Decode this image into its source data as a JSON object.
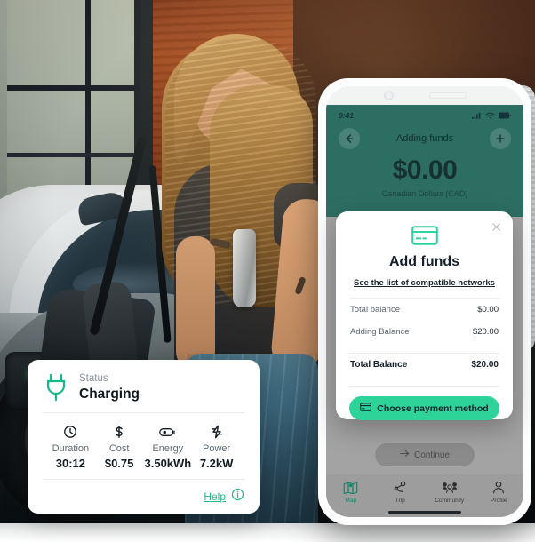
{
  "scene": {
    "description": "Woman leaning on a white electric car while it charges, with app UI overlays"
  },
  "status_card": {
    "icon": "plug-icon",
    "status_label": "Status",
    "status_value": "Charging",
    "metrics": [
      {
        "icon": "clock-icon",
        "label": "Duration",
        "value": "30:12"
      },
      {
        "icon": "dollar-icon",
        "label": "Cost",
        "value": "$0.75"
      },
      {
        "icon": "battery-icon",
        "label": "Energy",
        "value": "3.50kWh"
      },
      {
        "icon": "bolt-icon",
        "label": "Power",
        "value": "7.2kW"
      }
    ],
    "help_label": "Help",
    "help_icon": "info-icon"
  },
  "phone": {
    "status_bar": {
      "time": "9:41",
      "icons": [
        "cellular-signal-icon",
        "wifi-icon",
        "battery-icon"
      ]
    },
    "header": {
      "back_icon": "arrow-left-icon",
      "title": "Adding funds",
      "add_icon": "plus-icon",
      "amount": "$0.00",
      "currency": "Canadian Dollars (CAD)",
      "background_color": "#2d6e63"
    },
    "continue_button": {
      "label": "Continue",
      "icon": "arrow-right-icon"
    },
    "tabbar": [
      {
        "icon": "map-icon",
        "label": "Map",
        "active": true
      },
      {
        "icon": "trip-icon",
        "label": "Trip",
        "active": false
      },
      {
        "icon": "community-icon",
        "label": "Community",
        "active": false
      },
      {
        "icon": "profile-icon",
        "label": "Profile",
        "active": false
      }
    ]
  },
  "modal": {
    "close_icon": "close-icon",
    "card_icon": "credit-card-icon",
    "title": "Add funds",
    "link": "See the list of compatible networks",
    "rows": [
      {
        "key": "Total balance",
        "value": "$0.00"
      },
      {
        "key": "Adding Balance",
        "value": "$20.00"
      }
    ],
    "total": {
      "key": "Total Balance",
      "value": "$20.00"
    },
    "pay_button": {
      "label": "Choose payment method",
      "icon": "credit-card-icon"
    }
  },
  "colors": {
    "teal_header": "#2d6e63",
    "accent_green": "#2ed39a",
    "help_green": "#1fb888",
    "tab_active": "#13876b"
  }
}
